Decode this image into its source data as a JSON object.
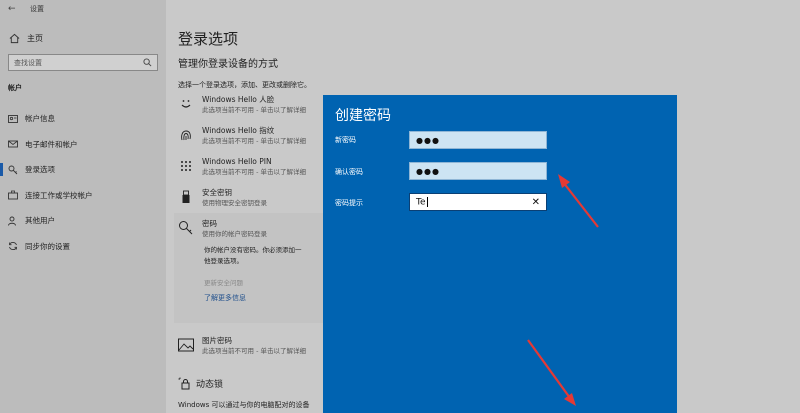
{
  "window": {
    "title": "设置"
  },
  "sidebar": {
    "home": "主页",
    "search_placeholder": "查找设置",
    "section": "帐户",
    "items": [
      {
        "label": "帐户信息",
        "icon": "person-card-icon"
      },
      {
        "label": "电子邮件和帐户",
        "icon": "mail-icon"
      },
      {
        "label": "登录选项",
        "icon": "key-icon",
        "active": true
      },
      {
        "label": "连接工作或学校帐户",
        "icon": "briefcase-icon"
      },
      {
        "label": "其他用户",
        "icon": "person-add-icon"
      },
      {
        "label": "同步你的设置",
        "icon": "sync-icon"
      }
    ]
  },
  "main": {
    "title": "登录选项",
    "subtitle": "管理你登录设备的方式",
    "hint": "选择一个登录选项，添加、更改或删除它。",
    "options": [
      {
        "title": "Windows Hello 人脸",
        "desc": "此选项当前不可用 - 单击以了解详细"
      },
      {
        "title": "Windows Hello 指纹",
        "desc": "此选项当前不可用 - 单击以了解详细"
      },
      {
        "title": "Windows Hello PIN",
        "desc": "此选项当前不可用 - 单击以了解详细"
      },
      {
        "title": "安全密钥",
        "desc": "使用物理安全密钥登录"
      }
    ],
    "password": {
      "title": "密码",
      "desc": "使用你的帐户密码登录",
      "body1": "你的帐户没有密码。你必须添加一",
      "body2": "他登录选项。",
      "change": "更新安全问题",
      "learn": "了解更多信息"
    },
    "picture": {
      "title": "图片密码",
      "desc": "此选项当前不可用 - 单击以了解详细"
    },
    "dynamic_lock": {
      "title": "动态锁",
      "desc": "Windows 可以通过与你的电脑配对的设备"
    }
  },
  "dialog": {
    "title": "创建密码",
    "fields": [
      {
        "label": "新密码",
        "value": "●●●"
      },
      {
        "label": "确认密码",
        "value": "●●●"
      },
      {
        "label": "密码提示",
        "value": "Te"
      }
    ]
  },
  "colors": {
    "dialog_bg": "#0063b1",
    "accent": "#1a5aa8",
    "arrow": "#e53935"
  }
}
